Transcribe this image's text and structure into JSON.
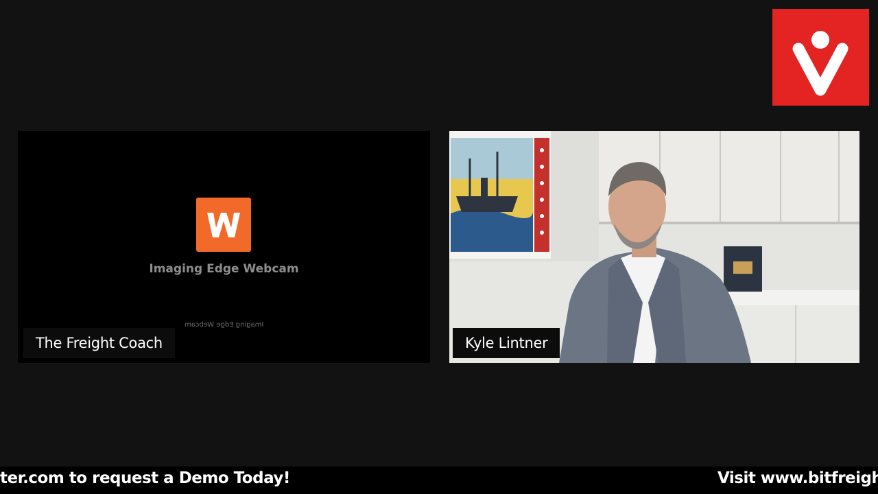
{
  "branding": {
    "logo_icon": "v-person-logo-icon",
    "logo_color": "#e42323"
  },
  "tiles": [
    {
      "participant_name": "The Freight Coach",
      "status": "camera-placeholder",
      "placeholder": {
        "app_icon": "imaging-edge-w-icon",
        "app_icon_color": "#f26a2a",
        "title": "Imaging Edge Webcam",
        "mirrored_caption": "Imaging Edge Webcam"
      }
    },
    {
      "participant_name": "Kyle Lintner",
      "status": "live-video"
    }
  ],
  "ticker": {
    "segment_left": "ter.com to request a Demo Today!",
    "segment_right": "Visit www.bitfreight"
  },
  "colors": {
    "background": "#121212",
    "label_background": "#0c0c0c",
    "ticker_background": "#000000"
  }
}
